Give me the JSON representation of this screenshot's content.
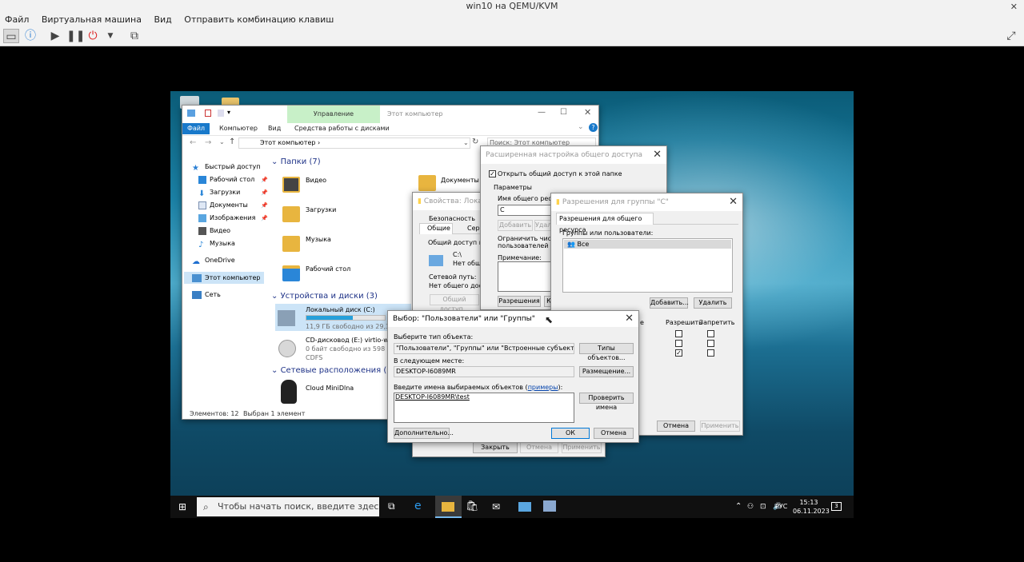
{
  "host": {
    "title": "win10 на QEMU/KVM",
    "menu": [
      "Файл",
      "Виртуальная машина",
      "Вид",
      "Отправить комбинацию клавиш"
    ]
  },
  "explorer": {
    "ribbon_context": "Управление",
    "title": "Этот компьютер",
    "tabs": [
      "Файл",
      "Компьютер",
      "Вид",
      "Средства работы с дисками"
    ],
    "path": "Этот компьютер",
    "search_placeholder": "Поиск: Этот компьютер",
    "nav": [
      "Быстрый доступ",
      "Рабочий стол",
      "Загрузки",
      "Документы",
      "Изображения",
      "Видео",
      "Музыка",
      "OneDrive",
      "Этот компьютер",
      "Сеть"
    ],
    "folders_header": "Папки (7)",
    "folders": [
      "Видео",
      "Загрузки",
      "Музыка",
      "Рабочий стол",
      "Документы"
    ],
    "drives_header": "Устройства и диски (3)",
    "drive_c": {
      "name": "Локальный диск (C:)",
      "free": "11,9 ГБ свободно из 29,3 ГБ",
      "used_fraction": 0.59
    },
    "drive_e": {
      "name": "CD-дисковод (E:) virtio-win-0",
      "free": "0 байт свободно из 598 МБ",
      "fs": "CDFS"
    },
    "net_header": "Сетевые расположения (2)",
    "net_item": "Cloud MiniDlna",
    "status_count": "Элементов: 12",
    "status_selected": "Выбран 1 элемент"
  },
  "props": {
    "title": "Свойства: Локаль",
    "tabs": [
      "Безопасность",
      "Общие",
      "Серв"
    ],
    "group_label": "Общий доступ к сет",
    "drive": "C:\\",
    "drive_status": "Нет общего",
    "net_path_label": "Сетевой путь:",
    "net_path_value": "Нет общего доступ",
    "share_btn": "Общий доступ...",
    "close": "Закрыть",
    "cancel": "Отмена",
    "apply": "Применить"
  },
  "advanced": {
    "title": "Расширенная настройка общего доступа",
    "share_check": "Открыть общий доступ к этой папке",
    "params": "Параметры",
    "share_name_label": "Имя общего ресурса:",
    "share_name": "C",
    "add_btn": "Добавить",
    "remove_btn": "Удал",
    "limit_label": "Ограничить число о",
    "limit_label2": "пользователей до:",
    "note_label": "Примечание:",
    "perm_btn": "Разрешения",
    "k_btn": "К"
  },
  "perms": {
    "title": "Разрешения для группы \"C\"",
    "tab": "Разрешения для общего ресурса",
    "groups_label": "Группы или пользователи:",
    "group_all": "Все",
    "add": "Добавить...",
    "remove": "Удалить",
    "col_allow": "Разрешить",
    "col_deny": "Запретить",
    "col_partial": "е",
    "cancel": "Отмена",
    "apply": "Применить"
  },
  "select": {
    "title": "Выбор: \"Пользователи\" или \"Группы\"",
    "type_label": "Выберите тип объекта:",
    "type_value": "\"Пользователи\", \"Группы\" или \"Встроенные субъекты безопасн",
    "type_btn": "Типы объектов...",
    "loc_label": "В следующем месте:",
    "loc_value": "DESKTOP-I6089MR",
    "loc_btn": "Размещение...",
    "names_label": "Введите имена выбираемых объектов (",
    "names_link": "примеры",
    "names_label_end": "):",
    "names_value": "DESKTOP-I6089MR\\test",
    "check_btn": "Проверить имена",
    "advanced_btn": "Дополнительно...",
    "ok": "ОК",
    "cancel": "Отмена"
  },
  "taskbar": {
    "search": "Чтобы начать поиск, введите здесь запрос",
    "lang": "РУС",
    "time": "15:13",
    "date": "06.11.2023",
    "notifications": "3"
  }
}
